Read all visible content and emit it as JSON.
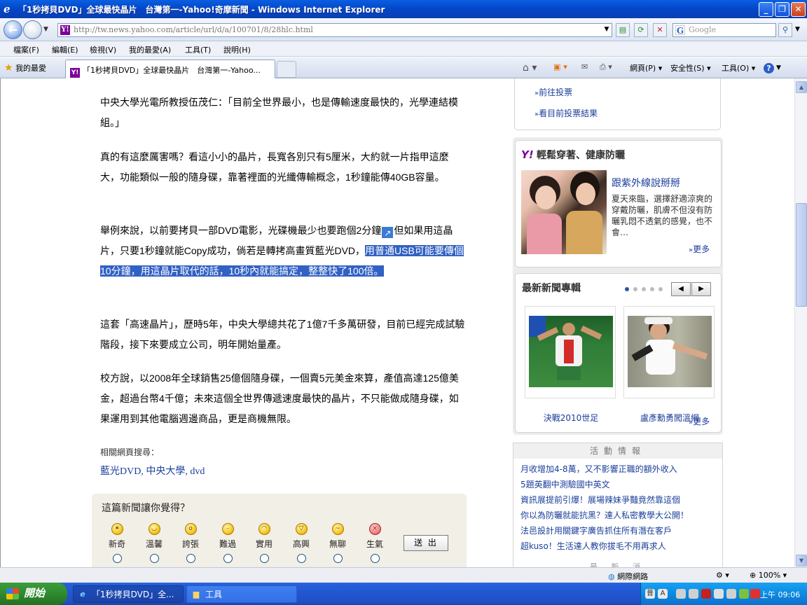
{
  "window": {
    "title": "「1秒拷貝DVD」全球最快晶片　台灣第一-Yahoo!奇摩新聞 - Windows Internet Explorer"
  },
  "address": {
    "url": "http://tw.news.yahoo.com/article/url/d/a/100701/8/28hlc.html",
    "search_placeholder": "Google"
  },
  "menu": [
    "檔案(F)",
    "編輯(E)",
    "檢視(V)",
    "我的最愛(A)",
    "工具(T)",
    "說明(H)"
  ],
  "tabbar": {
    "favorites": "我的最愛",
    "tab_title": "「1秒拷貝DVD」全球最快晶片　台灣第一-Yahoo...",
    "page_cmd": "網頁(P)",
    "safety_cmd": "安全性(S)",
    "tools_cmd": "工具(O)"
  },
  "article": {
    "p1": "中央大學光電所教授伍茂仁：「目前全世界最小，也是傳輸速度最快的，光學連結模組。」",
    "p2": "真的有這麼厲害嗎？看這小小的晶片，長寬各別只有5厘米，大約就一片指甲這麼大，功能類似一般的隨身碟，靠著裡面的光纖傳輸概念，1秒鐘能傳40GB容量。",
    "p3_a": "舉例來說，以前要拷貝一部DVD電影，光碟機最少也要跑個2分鐘",
    "p3_b": "但如果用這晶片，只要1秒鐘就能Copy成功，倘若是轉拷高畫質藍光DVD，",
    "p3_hl": "用普通USB可能要傳個10分鐘，用這晶片取代的話，10秒內就能搞定，整整快了100倍。",
    "p4": "這套「高速晶片」，歷時5年，中央大學總共花了1億7千多萬研發，目前已經完成試驗階段，接下來要成立公司，明年開始量產。",
    "p5": "校方說，以2008年全球銷售25億個隨身碟，一個賣5元美金來算，產值高達125億美金，超過台幣4千億；未來這個全世界傳遞速度最快的晶片，不只能做成隨身碟，如果運用到其他電腦週邊商品，更是商機無限。",
    "related_label": "相關網頁搜尋：",
    "related_links": [
      "藍光DVD",
      "中央大學",
      "dvd"
    ]
  },
  "poll": {
    "question": "這篇新聞讓你覺得？",
    "options": [
      "新奇",
      "溫馨",
      "誇張",
      "難過",
      "實用",
      "高興",
      "無聊",
      "生氣"
    ],
    "submit": "送 出"
  },
  "sidebar": {
    "vote_links": [
      "前往投票",
      "看目前投票結果"
    ],
    "health": {
      "title": "輕鬆穿著、健康防曬",
      "headline": "跟紫外線說掰掰",
      "desc": "夏天來臨，選擇舒適涼爽的穿戴防曬，肌膚不但沒有防曬乳悶不透氣的感覺，也不會…",
      "more": "更多"
    },
    "news_topics": {
      "title": "最新新聞專輯",
      "items": [
        "決戰2010世足",
        "盧彥勳勇闖溫網"
      ],
      "more": "更多"
    },
    "activity": {
      "title": "活動情報",
      "items": [
        "月收增加4-8萬，又不影響正職的額外收入",
        "5題英翻中測驗國中英文",
        "資訊展提前引爆！展場辣妹爭豔竟然靠這個",
        "你以為防曬就能抗黑？達人私密教學大公開！",
        "法邑設計用關鍵字廣告抓住所有潛在客戶",
        "超kuso！生活達人教你拔毛不用再求人"
      ],
      "footer": "最 新 消"
    }
  },
  "status": {
    "zone": "網際網路",
    "zoom": "100%"
  },
  "taskbar": {
    "start": "開始",
    "tasks": [
      "「1秒拷貝DVD」全...",
      "工具"
    ],
    "clock": "上午 09:06"
  }
}
